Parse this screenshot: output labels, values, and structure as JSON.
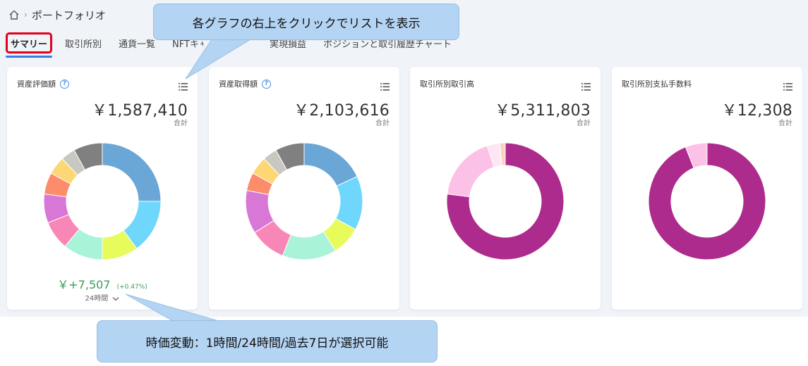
{
  "breadcrumb": {
    "home_icon": "home-icon",
    "separator": "›",
    "current": "ポートフォリオ"
  },
  "tabs": [
    {
      "label": "サマリー",
      "active": true
    },
    {
      "label": "取引所別",
      "active": false
    },
    {
      "label": "通貨一覧",
      "active": false
    },
    {
      "label": "NFTキャ",
      "active": false
    },
    {
      "label": "実現損益",
      "active": false
    },
    {
      "label": "ポジションと取引履歴チャート",
      "active": false
    }
  ],
  "cards": [
    {
      "title": "資産評価額",
      "help": "?",
      "value": "￥1,587,410",
      "sub": "合計",
      "slices": [
        {
          "value": 25,
          "color": "#6aa6d6"
        },
        {
          "value": 15,
          "color": "#6fd7fb"
        },
        {
          "value": 10,
          "color": "#e7fb5a"
        },
        {
          "value": 11,
          "color": "#a9f3d9"
        },
        {
          "value": 8,
          "color": "#f886b7"
        },
        {
          "value": 8,
          "color": "#d877d6"
        },
        {
          "value": 6,
          "color": "#fc8c6a"
        },
        {
          "value": 5,
          "color": "#fdd773"
        },
        {
          "value": 4,
          "color": "#c8c8c0"
        },
        {
          "value": 8,
          "color": "#808080"
        }
      ],
      "change": {
        "amount": "￥+7,507",
        "percent": "(+0.47%)",
        "period": "24時間"
      }
    },
    {
      "title": "資産取得額",
      "help": "?",
      "value": "￥2,103,616",
      "sub": "合計",
      "slices": [
        {
          "value": 18,
          "color": "#6aa6d6"
        },
        {
          "value": 15,
          "color": "#6fd7fb"
        },
        {
          "value": 8,
          "color": "#e7fb5a"
        },
        {
          "value": 15,
          "color": "#a9f3d9"
        },
        {
          "value": 10,
          "color": "#f886b7"
        },
        {
          "value": 12,
          "color": "#d877d6"
        },
        {
          "value": 5,
          "color": "#fc8c6a"
        },
        {
          "value": 5,
          "color": "#fdd773"
        },
        {
          "value": 4,
          "color": "#c8c8c0"
        },
        {
          "value": 8,
          "color": "#808080"
        }
      ]
    },
    {
      "title": "取引所別取引高",
      "value": "￥5,311,803",
      "sub": "合計",
      "slices": [
        {
          "value": 77,
          "color": "#ad2b8c"
        },
        {
          "value": 18,
          "color": "#fcc1e6"
        },
        {
          "value": 3.5,
          "color": "#ffe6f4"
        },
        {
          "value": 1.5,
          "color": "#fad3c3"
        }
      ]
    },
    {
      "title": "取引所別支払手数料",
      "value": "￥12,308",
      "sub": "合計",
      "slices": [
        {
          "value": 94,
          "color": "#ad2b8c"
        },
        {
          "value": 6,
          "color": "#fcc1e6"
        }
      ]
    }
  ],
  "callouts": {
    "top": "各グラフの右上をクリックでリストを表示",
    "bottom": "時価変動：1時間/24時間/過去7日が選択可能"
  }
}
